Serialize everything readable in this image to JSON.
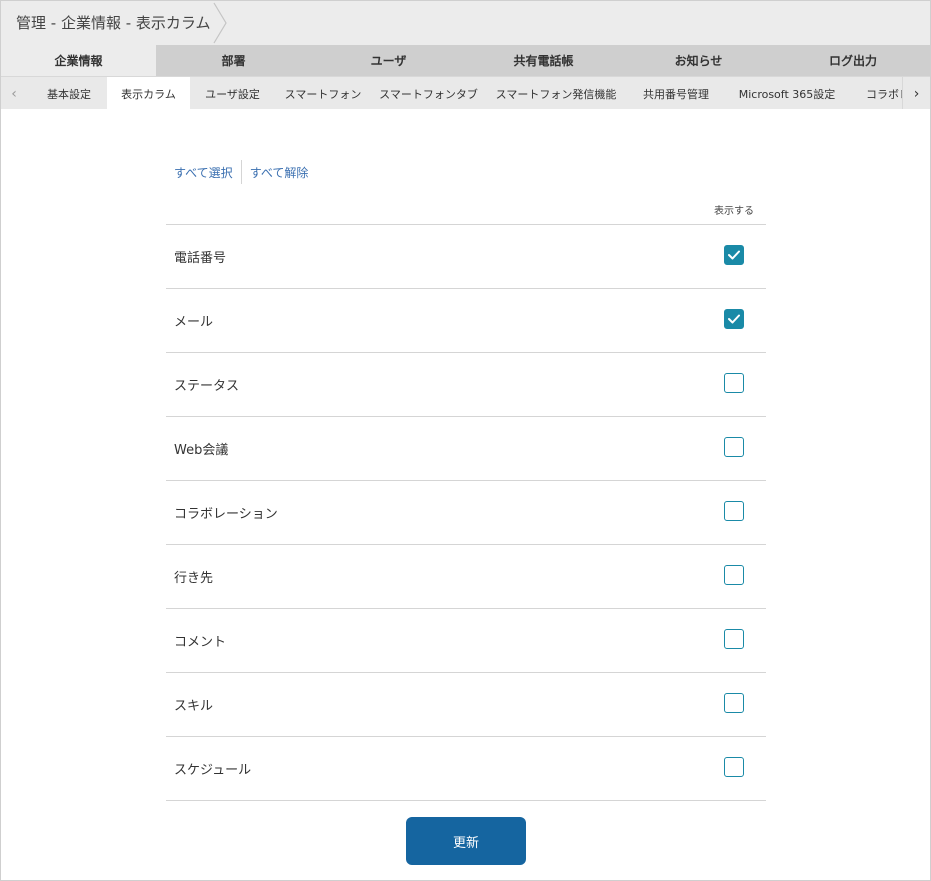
{
  "breadcrumb": {
    "text": "管理 - 企業情報 - 表示カラム"
  },
  "main_tabs": [
    {
      "label": "企業情報",
      "active": true
    },
    {
      "label": "部署",
      "active": false
    },
    {
      "label": "ユーザ",
      "active": false
    },
    {
      "label": "共有電話帳",
      "active": false
    },
    {
      "label": "お知らせ",
      "active": false
    },
    {
      "label": "ログ出力",
      "active": false
    }
  ],
  "sub_tabs": [
    {
      "label": "基本設定",
      "active": false
    },
    {
      "label": "表示カラム",
      "active": true
    },
    {
      "label": "ユーザ設定",
      "active": false
    },
    {
      "label": "スマートフォン",
      "active": false
    },
    {
      "label": "スマートフォンタブ",
      "active": false
    },
    {
      "label": "スマートフォン発信機能",
      "active": false
    },
    {
      "label": "共用番号管理",
      "active": false
    },
    {
      "label": "Microsoft 365設定",
      "active": false
    },
    {
      "label": "コラボレ",
      "active": false
    }
  ],
  "sub_arrows": {
    "left": "‹",
    "right": "›"
  },
  "selection": {
    "select_all": "すべて選択",
    "deselect_all": "すべて解除"
  },
  "table": {
    "column_header": "表示する",
    "rows": [
      {
        "label": "電話番号",
        "checked": true
      },
      {
        "label": "メール",
        "checked": true
      },
      {
        "label": "ステータス",
        "checked": false
      },
      {
        "label": "Web会議",
        "checked": false
      },
      {
        "label": "コラボレーション",
        "checked": false
      },
      {
        "label": "行き先",
        "checked": false
      },
      {
        "label": "コメント",
        "checked": false
      },
      {
        "label": "スキル",
        "checked": false
      },
      {
        "label": "スケジュール",
        "checked": false
      }
    ]
  },
  "update_button": {
    "label": "更新"
  },
  "colors": {
    "accent": "#1a8aa7",
    "button": "#1565a0",
    "link": "#3a6fb0"
  }
}
